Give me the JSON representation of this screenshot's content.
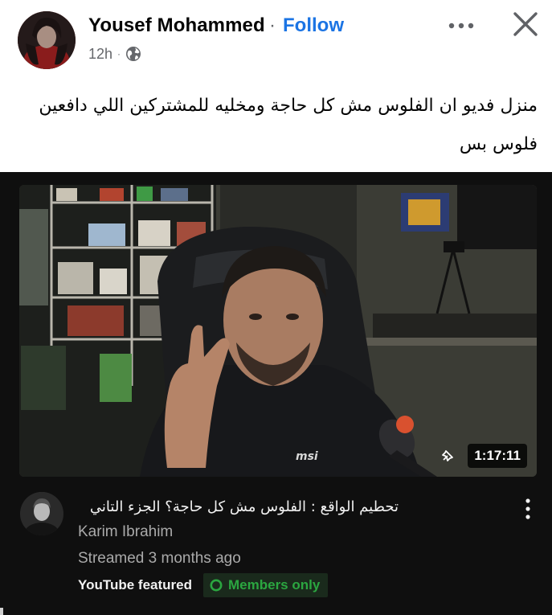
{
  "post": {
    "author_name": "Yousef Mohammed",
    "separator": "·",
    "follow_label": "Follow",
    "timestamp": "12h",
    "meta_dot": "·",
    "audience_icon": "globe-icon",
    "more_icon": "more-horizontal-icon",
    "close_icon": "close-icon",
    "text_line_1": "منزل فديو ان الفلوس مش كل حاجة ومخليه للمشتركين اللي دافعين",
    "text_line_2": "فلوس بس"
  },
  "video": {
    "duration": "1:17:11",
    "title": "تحطيم الواقع : الفلوس مش كل حاجة؟ الجزء التاني",
    "channel_name": "Karim Ibrahim",
    "stream_info": "Streamed 3 months ago",
    "featured_label": "YouTube featured",
    "members_label": "Members only",
    "menu_icon": "kebab-menu-icon"
  },
  "colors": {
    "brand_blue": "#1b74e4",
    "members_green": "#2ba640",
    "card_bg": "#0f0f0f"
  }
}
